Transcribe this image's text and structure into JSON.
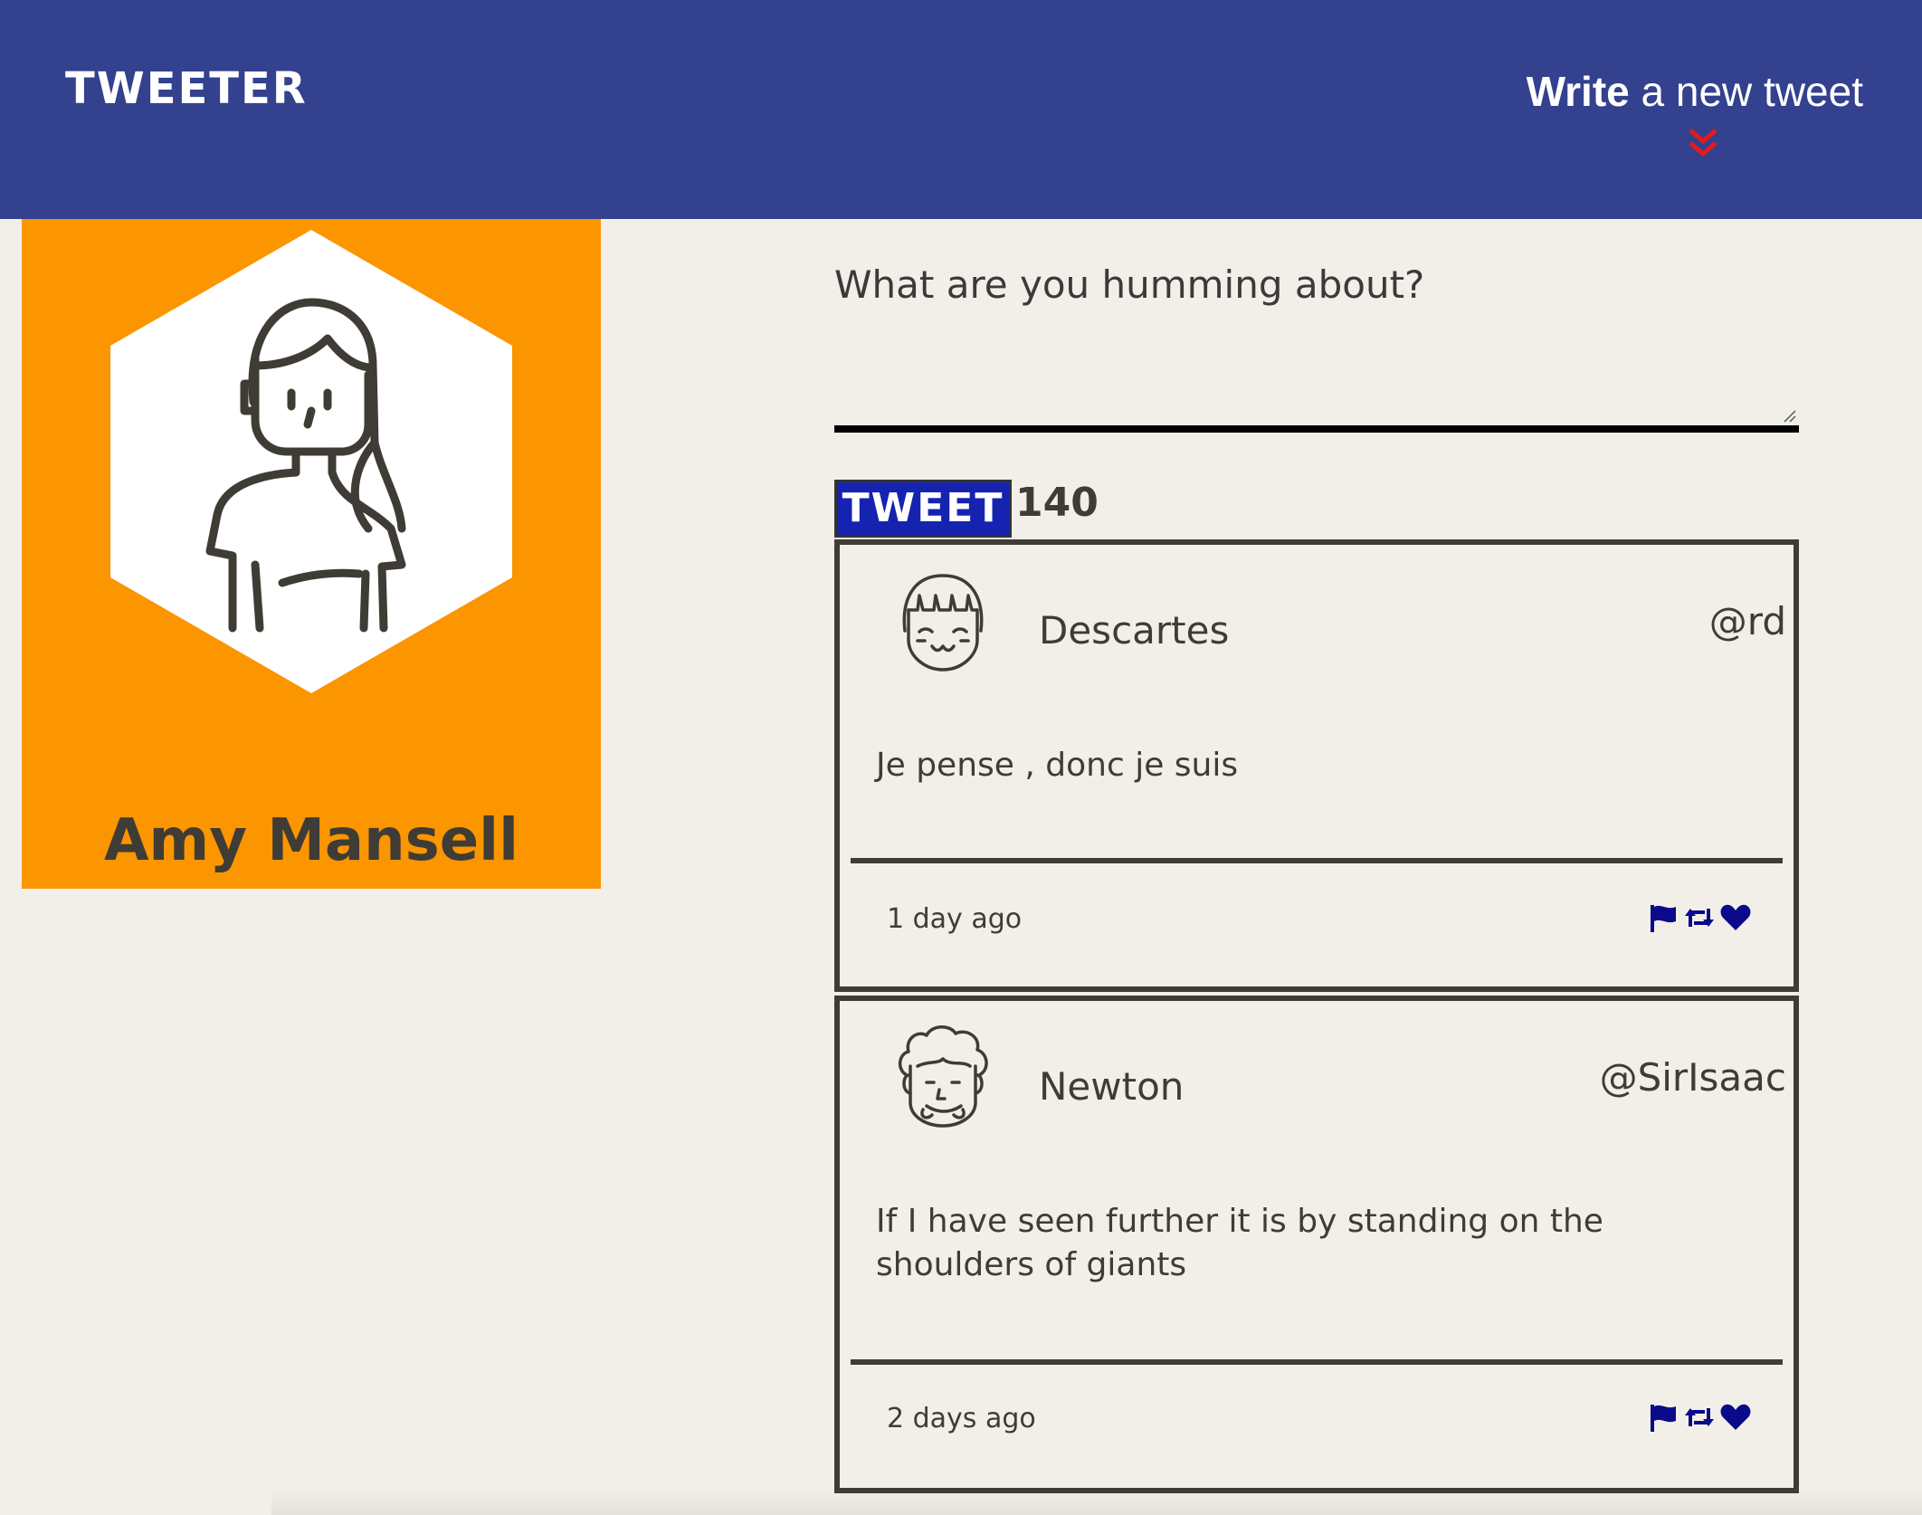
{
  "navbar": {
    "brand": "TWEETER",
    "compose_toggle_bold": "Write",
    "compose_toggle_rest": " a new tweet",
    "chevron_icon": "double-chevron-down-icon",
    "background_color": "#33418e",
    "chevron_color": "#e21b1b"
  },
  "profile": {
    "name": "Amy Mansell",
    "avatar_icon": "woman-avatar-icon",
    "background_color": "#fb9500"
  },
  "compose": {
    "placeholder": "What are you humming about?",
    "value": "",
    "submit_label": "TWEET",
    "char_counter": "140"
  },
  "tweets": [
    {
      "name": "Descartes",
      "handle": "@rd",
      "content": "Je pense , donc je suis",
      "time": "1 day ago",
      "avatar_icon": "smiling-girl-avatar-icon"
    },
    {
      "name": "Newton",
      "handle": "@SirIsaac",
      "content": "If I have seen further it is by standing on the shoulders of giants",
      "time": "2 days ago",
      "avatar_icon": "curly-hair-man-avatar-icon"
    }
  ],
  "actions": {
    "icons": [
      "flag-icon",
      "retweet-icon",
      "heart-icon"
    ],
    "color": "#0a0a8a"
  }
}
